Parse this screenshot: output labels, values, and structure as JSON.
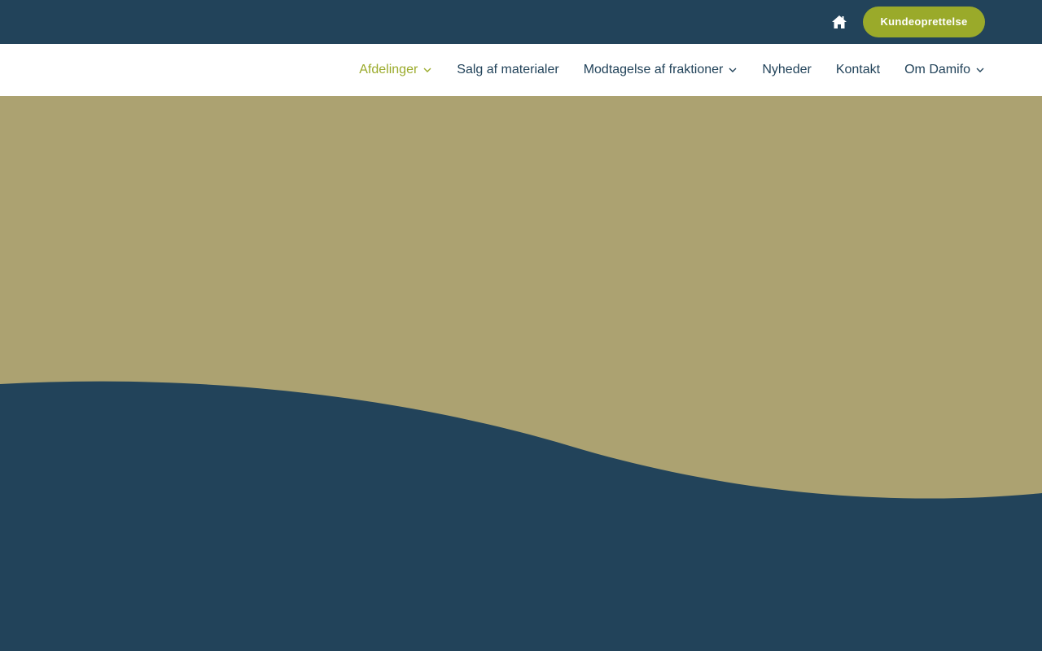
{
  "topbar": {
    "home_icon": "home-icon",
    "cta_label": "Kundeoprettelse"
  },
  "nav": {
    "items": [
      {
        "label": "Afdelinger",
        "active": true,
        "has_dropdown": true
      },
      {
        "label": "Salg af materialer",
        "active": false,
        "has_dropdown": false
      },
      {
        "label": "Modtagelse af fraktioner",
        "active": false,
        "has_dropdown": true
      },
      {
        "label": "Nyheder",
        "active": false,
        "has_dropdown": false
      },
      {
        "label": "Kontakt",
        "active": false,
        "has_dropdown": false
      },
      {
        "label": "Om Damifo",
        "active": false,
        "has_dropdown": true
      }
    ]
  },
  "colors": {
    "navy": "#22435a",
    "accent_green": "#9aaa2a",
    "hero_khaki": "#aca271",
    "white": "#ffffff"
  }
}
